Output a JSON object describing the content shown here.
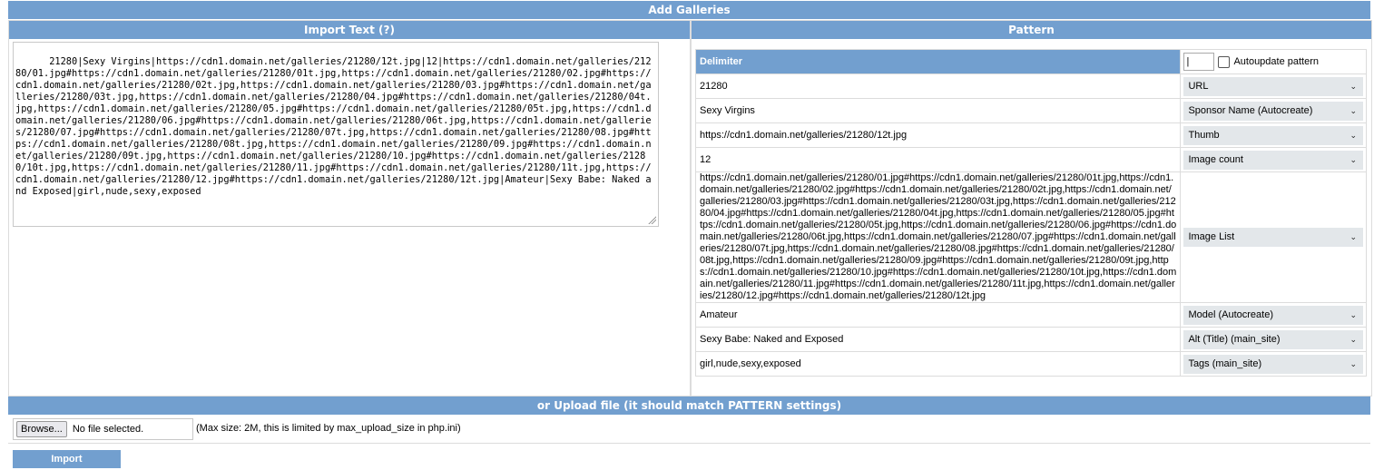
{
  "main_title": "Add Galleries",
  "import_text": {
    "title": "Import Text (?)",
    "content": "21280|Sexy Virgins|https://cdn1.domain.net/galleries/21280/12t.jpg|12|https://cdn1.domain.net/galleries/21280/01.jpg#https://cdn1.domain.net/galleries/21280/01t.jpg,https://cdn1.domain.net/galleries/21280/02.jpg#https://cdn1.domain.net/galleries/21280/02t.jpg,https://cdn1.domain.net/galleries/21280/03.jpg#https://cdn1.domain.net/galleries/21280/03t.jpg,https://cdn1.domain.net/galleries/21280/04.jpg#https://cdn1.domain.net/galleries/21280/04t.jpg,https://cdn1.domain.net/galleries/21280/05.jpg#https://cdn1.domain.net/galleries/21280/05t.jpg,https://cdn1.domain.net/galleries/21280/06.jpg#https://cdn1.domain.net/galleries/21280/06t.jpg,https://cdn1.domain.net/galleries/21280/07.jpg#https://cdn1.domain.net/galleries/21280/07t.jpg,https://cdn1.domain.net/galleries/21280/08.jpg#https://cdn1.domain.net/galleries/21280/08t.jpg,https://cdn1.domain.net/galleries/21280/09.jpg#https://cdn1.domain.net/galleries/21280/09t.jpg,https://cdn1.domain.net/galleries/21280/10.jpg#https://cdn1.domain.net/galleries/21280/10t.jpg,https://cdn1.domain.net/galleries/21280/11.jpg#https://cdn1.domain.net/galleries/21280/11t.jpg,https://cdn1.domain.net/galleries/21280/12.jpg#https://cdn1.domain.net/galleries/21280/12t.jpg|Amateur|Sexy Babe: Naked and Exposed|girl,nude,sexy,exposed"
  },
  "pattern": {
    "title": "Pattern",
    "delimiter_label": "Delimiter",
    "delimiter_value": "|",
    "autoupdate_label": "Autoupdate pattern",
    "rows": [
      {
        "value": "21280",
        "field": "URL"
      },
      {
        "value": "Sexy Virgins",
        "field": "Sponsor Name (Autocreate)"
      },
      {
        "value": "https://cdn1.domain.net/galleries/21280/12t.jpg",
        "field": "Thumb"
      },
      {
        "value": "12",
        "field": "Image count"
      },
      {
        "value": "https://cdn1.domain.net/galleries/21280/01.jpg#https://cdn1.domain.net/galleries/21280/01t.jpg,https://cdn1.domain.net/galleries/21280/02.jpg#https://cdn1.domain.net/galleries/21280/02t.jpg,https://cdn1.domain.net/galleries/21280/03.jpg#https://cdn1.domain.net/galleries/21280/03t.jpg,https://cdn1.domain.net/galleries/21280/04.jpg#https://cdn1.domain.net/galleries/21280/04t.jpg,https://cdn1.domain.net/galleries/21280/05.jpg#https://cdn1.domain.net/galleries/21280/05t.jpg,https://cdn1.domain.net/galleries/21280/06.jpg#https://cdn1.domain.net/galleries/21280/06t.jpg,https://cdn1.domain.net/galleries/21280/07.jpg#https://cdn1.domain.net/galleries/21280/07t.jpg,https://cdn1.domain.net/galleries/21280/08.jpg#https://cdn1.domain.net/galleries/21280/08t.jpg,https://cdn1.domain.net/galleries/21280/09.jpg#https://cdn1.domain.net/galleries/21280/09t.jpg,https://cdn1.domain.net/galleries/21280/10.jpg#https://cdn1.domain.net/galleries/21280/10t.jpg,https://cdn1.domain.net/galleries/21280/11.jpg#https://cdn1.domain.net/galleries/21280/11t.jpg,https://cdn1.domain.net/galleries/21280/12.jpg#https://cdn1.domain.net/galleries/21280/12t.jpg",
        "field": "Image List"
      },
      {
        "value": "Amateur",
        "field": "Model (Autocreate)"
      },
      {
        "value": "Sexy Babe: Naked and Exposed",
        "field": "Alt (Title) (main_site)"
      },
      {
        "value": "girl,nude,sexy,exposed",
        "field": "Tags (main_site)"
      }
    ]
  },
  "upload": {
    "title": "or Upload file (it should match PATTERN settings)",
    "browse_label": "Browse...",
    "no_file_label": "No file selected.",
    "max_size_note": "(Max size: 2M, this is limited by max_upload_size in php.ini)"
  },
  "import_button_label": "Import",
  "colors": {
    "header": "#729fcf",
    "select_bg": "#e3e7ea"
  }
}
